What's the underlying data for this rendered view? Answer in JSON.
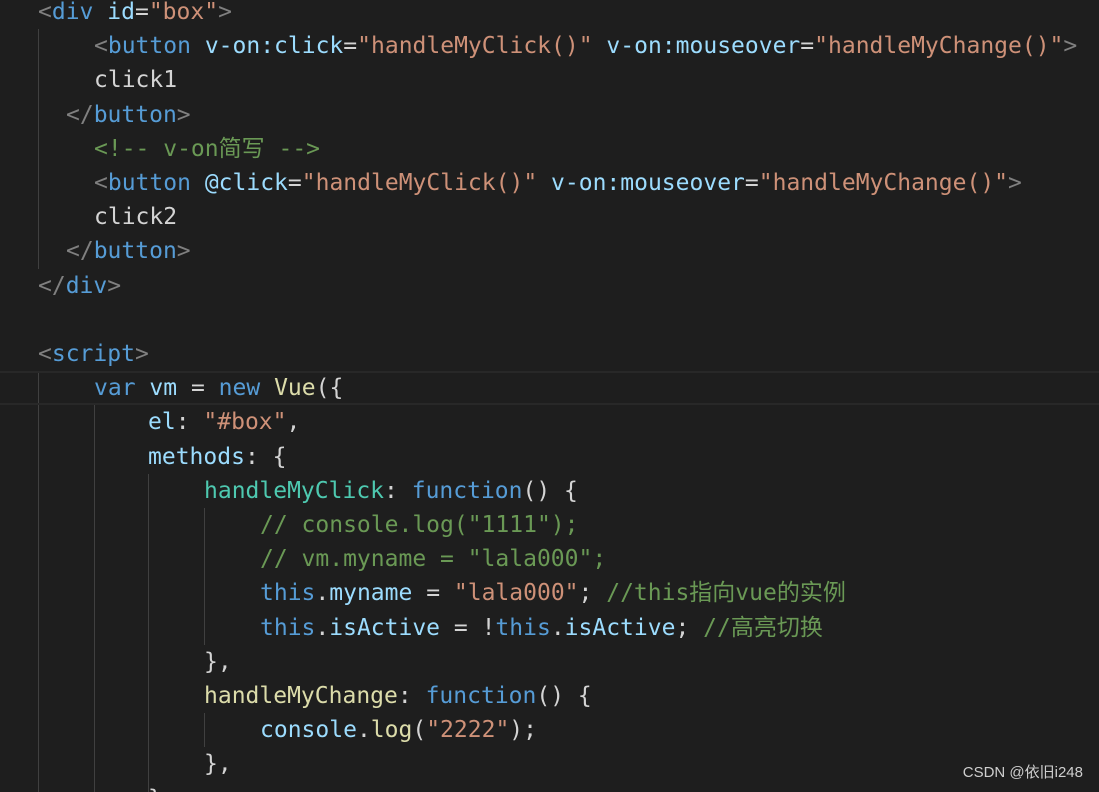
{
  "editor": {
    "lines": [
      [
        {
          "t": "<",
          "c": "punc"
        },
        {
          "t": "div",
          "c": "tag"
        },
        {
          "t": " ",
          "c": "text"
        },
        {
          "t": "id",
          "c": "attr"
        },
        {
          "t": "=",
          "c": "op"
        },
        {
          "t": "\"box\"",
          "c": "str"
        },
        {
          "t": ">",
          "c": "punc"
        }
      ],
      [
        {
          "t": "<",
          "c": "punc"
        },
        {
          "t": "button",
          "c": "tag"
        },
        {
          "t": " ",
          "c": "text"
        },
        {
          "t": "v-on:click",
          "c": "attr"
        },
        {
          "t": "=",
          "c": "op"
        },
        {
          "t": "\"handleMyClick()\"",
          "c": "str"
        },
        {
          "t": " ",
          "c": "text"
        },
        {
          "t": "v-on:mouseover",
          "c": "attr"
        },
        {
          "t": "=",
          "c": "op"
        },
        {
          "t": "\"handleMyChange()\"",
          "c": "str"
        },
        {
          "t": ">",
          "c": "punc"
        }
      ],
      [
        {
          "t": "click1",
          "c": "text"
        }
      ],
      [
        {
          "t": "</",
          "c": "punc"
        },
        {
          "t": "button",
          "c": "tag"
        },
        {
          "t": ">",
          "c": "punc"
        }
      ],
      [
        {
          "t": "<!-- v-on简写 -->",
          "c": "comment"
        }
      ],
      [
        {
          "t": "<",
          "c": "punc"
        },
        {
          "t": "button",
          "c": "tag"
        },
        {
          "t": " ",
          "c": "text"
        },
        {
          "t": "@click",
          "c": "attr"
        },
        {
          "t": "=",
          "c": "op"
        },
        {
          "t": "\"handleMyClick()\"",
          "c": "str"
        },
        {
          "t": " ",
          "c": "text"
        },
        {
          "t": "v-on:mouseover",
          "c": "attr"
        },
        {
          "t": "=",
          "c": "op"
        },
        {
          "t": "\"handleMyChange()\"",
          "c": "str"
        },
        {
          "t": ">",
          "c": "punc"
        }
      ],
      [
        {
          "t": "click2",
          "c": "text"
        }
      ],
      [
        {
          "t": "</",
          "c": "punc"
        },
        {
          "t": "button",
          "c": "tag"
        },
        {
          "t": ">",
          "c": "punc"
        }
      ],
      [
        {
          "t": "</",
          "c": "punc"
        },
        {
          "t": "div",
          "c": "tag"
        },
        {
          "t": ">",
          "c": "punc"
        }
      ],
      [],
      [
        {
          "t": "<",
          "c": "punc"
        },
        {
          "t": "script",
          "c": "tag"
        },
        {
          "t": ">",
          "c": "punc"
        }
      ],
      [
        {
          "t": "var",
          "c": "kw"
        },
        {
          "t": " ",
          "c": "text"
        },
        {
          "t": "vm",
          "c": "var"
        },
        {
          "t": " = ",
          "c": "op"
        },
        {
          "t": "new",
          "c": "kw"
        },
        {
          "t": " ",
          "c": "text"
        },
        {
          "t": "Vue",
          "c": "fn"
        },
        {
          "t": "(",
          "c": "op"
        },
        {
          "t": "{",
          "c": "op"
        }
      ],
      [
        {
          "t": "el",
          "c": "prop"
        },
        {
          "t": ": ",
          "c": "op"
        },
        {
          "t": "\"#box\"",
          "c": "str"
        },
        {
          "t": ",",
          "c": "op"
        }
      ],
      [
        {
          "t": "methods",
          "c": "prop"
        },
        {
          "t": ": {",
          "c": "op"
        }
      ],
      [
        {
          "t": "handleMyClick",
          "c": "method"
        },
        {
          "t": ": ",
          "c": "op"
        },
        {
          "t": "function",
          "c": "kw"
        },
        {
          "t": "() {",
          "c": "op"
        }
      ],
      [
        {
          "t": "// console.log(\"1111\");",
          "c": "comment"
        }
      ],
      [
        {
          "t": "// vm.myname = \"lala000\";",
          "c": "comment"
        }
      ],
      [
        {
          "t": "this",
          "c": "kw"
        },
        {
          "t": ".",
          "c": "op"
        },
        {
          "t": "myname",
          "c": "prop"
        },
        {
          "t": " = ",
          "c": "op"
        },
        {
          "t": "\"lala000\"",
          "c": "str"
        },
        {
          "t": "; ",
          "c": "op"
        },
        {
          "t": "//this指向vue的实例",
          "c": "comment"
        }
      ],
      [
        {
          "t": "this",
          "c": "kw"
        },
        {
          "t": ".",
          "c": "op"
        },
        {
          "t": "isActive",
          "c": "prop"
        },
        {
          "t": " = !",
          "c": "op"
        },
        {
          "t": "this",
          "c": "kw"
        },
        {
          "t": ".",
          "c": "op"
        },
        {
          "t": "isActive",
          "c": "prop"
        },
        {
          "t": "; ",
          "c": "op"
        },
        {
          "t": "//高亮切换",
          "c": "comment"
        }
      ],
      [
        {
          "t": "},",
          "c": "op"
        }
      ],
      [
        {
          "t": "handleMyChange",
          "c": "fn"
        },
        {
          "t": ": ",
          "c": "op"
        },
        {
          "t": "function",
          "c": "kw"
        },
        {
          "t": "() {",
          "c": "op"
        }
      ],
      [
        {
          "t": "console",
          "c": "prop"
        },
        {
          "t": ".",
          "c": "op"
        },
        {
          "t": "log",
          "c": "fn"
        },
        {
          "t": "(",
          "c": "op"
        },
        {
          "t": "\"2222\"",
          "c": "str"
        },
        {
          "t": ");",
          "c": "op"
        }
      ],
      [
        {
          "t": "},",
          "c": "op"
        }
      ],
      [
        {
          "t": "},",
          "c": "op"
        }
      ]
    ]
  },
  "watermark": "CSDN @依旧i248",
  "colors": {
    "background": "#1e1e1e",
    "tag": "#569cd6",
    "attribute": "#9cdcfe",
    "string": "#ce9178",
    "comment": "#6a9955",
    "function": "#dcdcaa"
  }
}
